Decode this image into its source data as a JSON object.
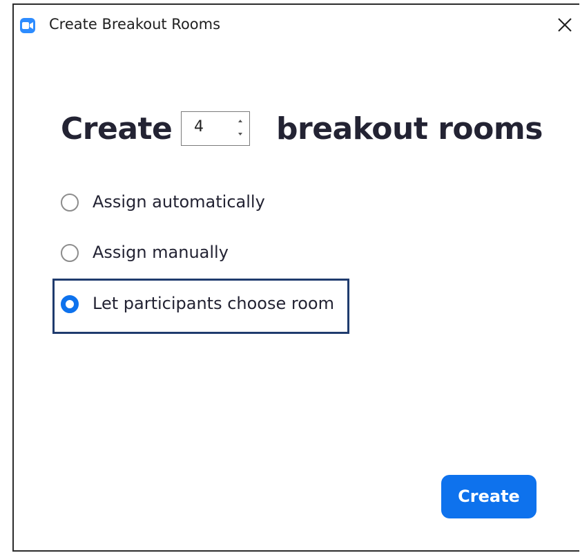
{
  "window": {
    "title": "Create Breakout Rooms",
    "app_icon": "zoom-camera-icon",
    "close_icon": "close-icon"
  },
  "heading": {
    "prefix": "Create",
    "suffix": "breakout rooms",
    "room_count": "4"
  },
  "options": [
    {
      "label": "Assign automatically",
      "selected": false
    },
    {
      "label": "Assign manually",
      "selected": false
    },
    {
      "label": "Let participants choose room",
      "selected": true
    }
  ],
  "actions": {
    "create_label": "Create"
  },
  "colors": {
    "accent": "#0e72ed",
    "highlight_border": "#1f3b6e",
    "text": "#232333"
  }
}
